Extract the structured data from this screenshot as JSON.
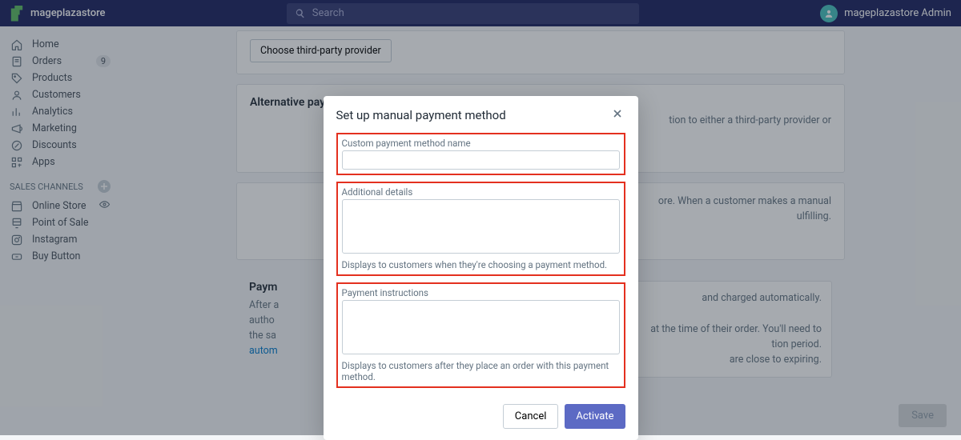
{
  "topbar": {
    "store_name": "mageplazastore",
    "search_placeholder": "Search",
    "admin_name": "mageplazastore Admin"
  },
  "nav": {
    "home": "Home",
    "orders": "Orders",
    "orders_badge": "9",
    "products": "Products",
    "customers": "Customers",
    "analytics": "Analytics",
    "marketing": "Marketing",
    "discounts": "Discounts",
    "apps": "Apps",
    "sales_channels": "SALES CHANNELS",
    "online_store": "Online Store",
    "pos": "Point of Sale",
    "instagram": "Instagram",
    "buy_button": "Buy Button"
  },
  "cards": {
    "choose_provider": "Choose third-party provider",
    "alt_title": "Alternative payment methods",
    "alt_desc": "tion to either a third-party provider or",
    "manual_desc1": "ore. When a customer makes a manual",
    "manual_desc2": "ulfilling.",
    "auth_title": "Paym",
    "auth_p1": "After a",
    "auth_p2": "autho",
    "auth_p3": "the sa",
    "auth_link": "autom",
    "auth_r1": "and charged automatically.",
    "auth_r2": "at the time of their order. You'll need to",
    "auth_r3": "tion period.",
    "auth_r4": "are close to expiring."
  },
  "save_button": "Save",
  "modal": {
    "title": "Set up manual payment method",
    "f1_label": "Custom payment method name",
    "f2_label": "Additional details",
    "f2_help": "Displays to customers when they're choosing a payment method.",
    "f3_label": "Payment instructions",
    "f3_help": "Displays to customers after they place an order with this payment method.",
    "cancel": "Cancel",
    "activate": "Activate"
  }
}
